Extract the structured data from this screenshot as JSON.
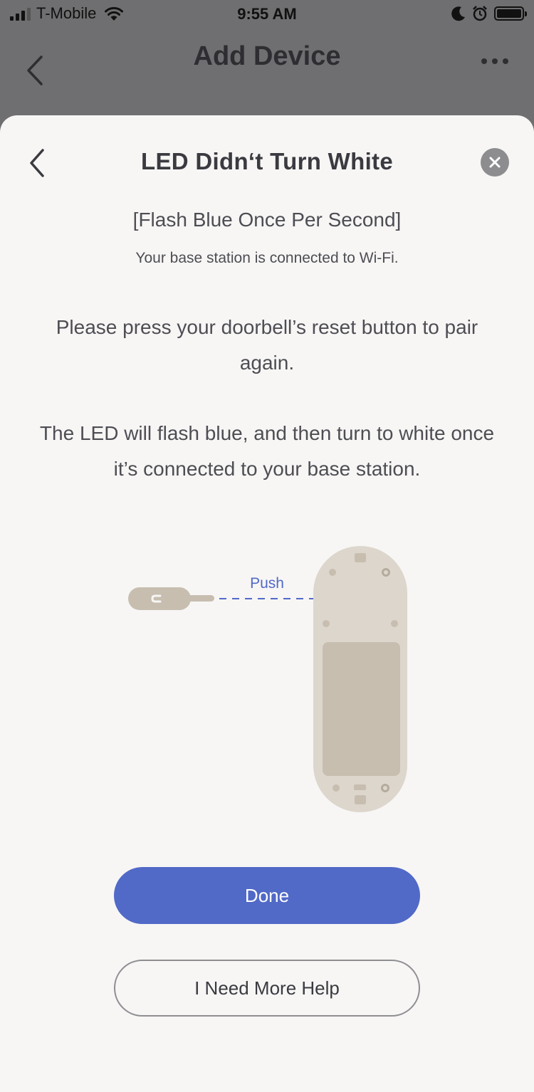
{
  "status_bar": {
    "carrier": "T-Mobile",
    "time": "9:55 AM",
    "icons": [
      "signal-icon",
      "wifi-icon",
      "moon-icon",
      "alarm-icon",
      "battery-icon"
    ]
  },
  "nav": {
    "title": "Add Device",
    "back_icon": "chevron-left-icon",
    "more_icon": "more-dots-icon"
  },
  "sheet": {
    "title": "LED Didn‘t Turn White",
    "subtitle": "[Flash Blue Once Per Second]",
    "note": "Your base station is connected to Wi-Fi.",
    "paragraph1": "Please press your doorbell’s reset button to pair again.",
    "paragraph2": "The LED will flash blue, and then turn to white once it’s connected to your base station.",
    "illustration": {
      "push_label": "Push"
    },
    "done_label": "Done",
    "help_label": "I Need More Help"
  },
  "colors": {
    "accent": "#5169c7",
    "sheet_bg": "#f7f6f5",
    "overlay": "#6f6e70",
    "device": "#ddd6cc",
    "device_panel": "#c7beb0",
    "text": "#4e4d53"
  }
}
